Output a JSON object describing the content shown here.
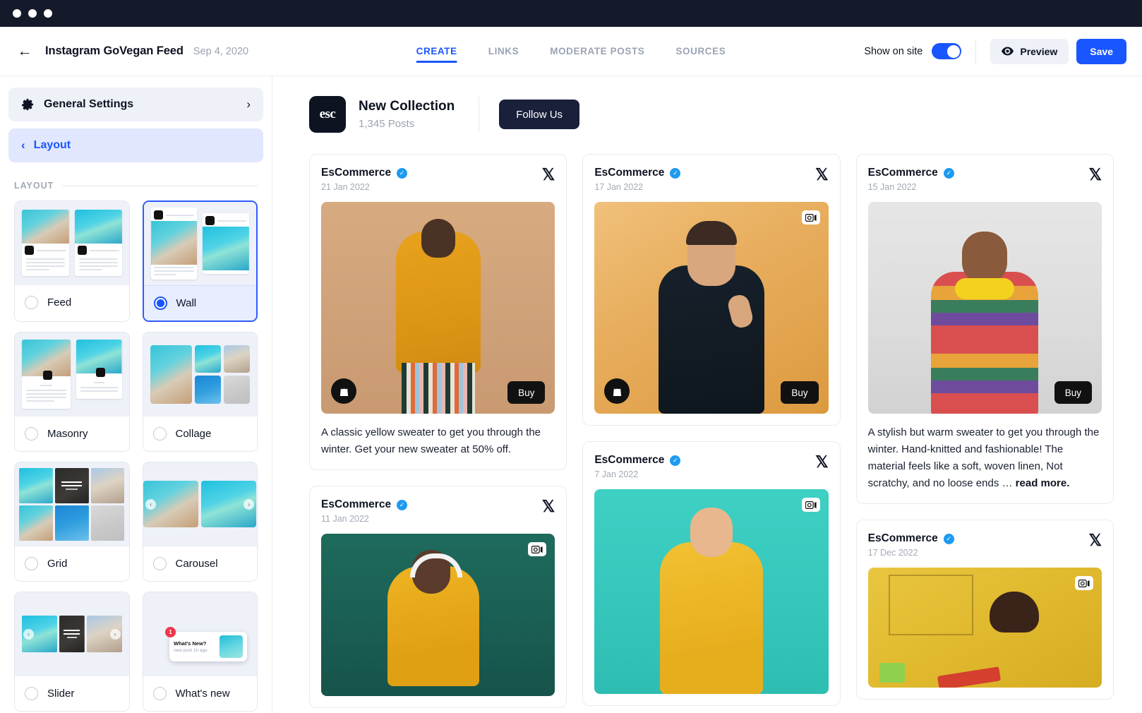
{
  "window": {
    "dots": 3
  },
  "appbar": {
    "back_icon": "arrow-left-icon",
    "title": "Instagram GoVegan Feed",
    "date": "Sep 4, 2020",
    "tabs": [
      {
        "label": "CREATE",
        "active": true
      },
      {
        "label": "LINKS",
        "active": false
      },
      {
        "label": "MODERATE POSTS",
        "active": false
      },
      {
        "label": "SOURCES",
        "active": false
      }
    ],
    "show_on_site_label": "Show on site",
    "show_on_site_value": true,
    "preview_label": "Preview",
    "preview_icon": "eye-icon",
    "save_label": "Save",
    "accent_color": "#1a56ff"
  },
  "sidebar": {
    "general_settings": {
      "label": "General Settings",
      "icon": "gear-icon",
      "chevron": "chevron-right-icon"
    },
    "layout_nav": {
      "label": "Layout",
      "chevron": "chevron-left-icon",
      "active": true
    },
    "section_title": "LAYOUT",
    "options": [
      {
        "label": "Feed",
        "selected": false,
        "preview": "feed"
      },
      {
        "label": "Wall",
        "selected": true,
        "preview": "wall"
      },
      {
        "label": "Masonry",
        "selected": false,
        "preview": "masonry"
      },
      {
        "label": "Collage",
        "selected": false,
        "preview": "collage"
      },
      {
        "label": "Grid",
        "selected": false,
        "preview": "grid"
      },
      {
        "label": "Carousel",
        "selected": false,
        "preview": "carousel"
      },
      {
        "label": "Slider",
        "selected": false,
        "preview": "slider"
      },
      {
        "label": "What's new",
        "selected": false,
        "preview": "whatsnew"
      }
    ],
    "whatsnew_chip": {
      "title": "What's New?",
      "subtitle": "new post 1h ago",
      "badge": "1"
    }
  },
  "feed": {
    "logo_text": "esc",
    "collection_title": "New Collection",
    "post_count": "1,345 Posts",
    "follow_label": "Follow Us",
    "columns": [
      {
        "posts": [
          {
            "author": "EsCommerce",
            "verified": true,
            "date": "21 Jan 2022",
            "network_icon": "x-twitter-icon",
            "media_height": 300,
            "media_style": "model-yellow-sweater",
            "shop_badge": "shopping-bag-icon",
            "buy_label": "Buy",
            "carousel_badge": false,
            "caption": "A classic yellow sweater to get you through the winter. Get your new sweater at 50% off.",
            "caption_more": ""
          },
          {
            "author": "EsCommerce",
            "verified": true,
            "date": "11 Jan 2022",
            "network_icon": "x-twitter-icon",
            "media_height": 230,
            "media_style": "model-green-headphones",
            "shop_badge": "",
            "buy_label": "",
            "carousel_badge": true,
            "caption": "",
            "caption_more": ""
          }
        ]
      },
      {
        "posts": [
          {
            "author": "EsCommerce",
            "verified": true,
            "date": "17 Jan 2022",
            "network_icon": "x-twitter-icon",
            "media_height": 300,
            "media_style": "model-orange-callme",
            "shop_badge": "shopping-bag-icon",
            "buy_label": "Buy",
            "carousel_badge": true,
            "caption": "",
            "caption_more": ""
          },
          {
            "author": "EsCommerce",
            "verified": true,
            "date": "7 Jan 2022",
            "network_icon": "x-twitter-icon",
            "media_height": 290,
            "media_style": "model-teal-girl",
            "shop_badge": "",
            "buy_label": "",
            "carousel_badge": true,
            "caption": "",
            "caption_more": ""
          }
        ]
      },
      {
        "posts": [
          {
            "author": "EsCommerce",
            "verified": true,
            "date": "15 Jan 2022",
            "network_icon": "x-twitter-icon",
            "media_height": 300,
            "media_style": "model-stripes-headphones",
            "shop_badge": "",
            "buy_label": "Buy",
            "carousel_badge": false,
            "caption": "A stylish but warm sweater to get you through the winter. Hand-knitted and fashionable! The material feels like a soft, woven linen, Not scratchy, and no loose ends … ",
            "caption_more": "read more."
          },
          {
            "author": "EsCommerce",
            "verified": true,
            "date": "17 Dec 2022",
            "network_icon": "x-twitter-icon",
            "media_height": 170,
            "media_style": "model-yellow-paint",
            "shop_badge": "",
            "buy_label": "",
            "carousel_badge": true,
            "caption": "",
            "caption_more": ""
          }
        ]
      }
    ]
  }
}
